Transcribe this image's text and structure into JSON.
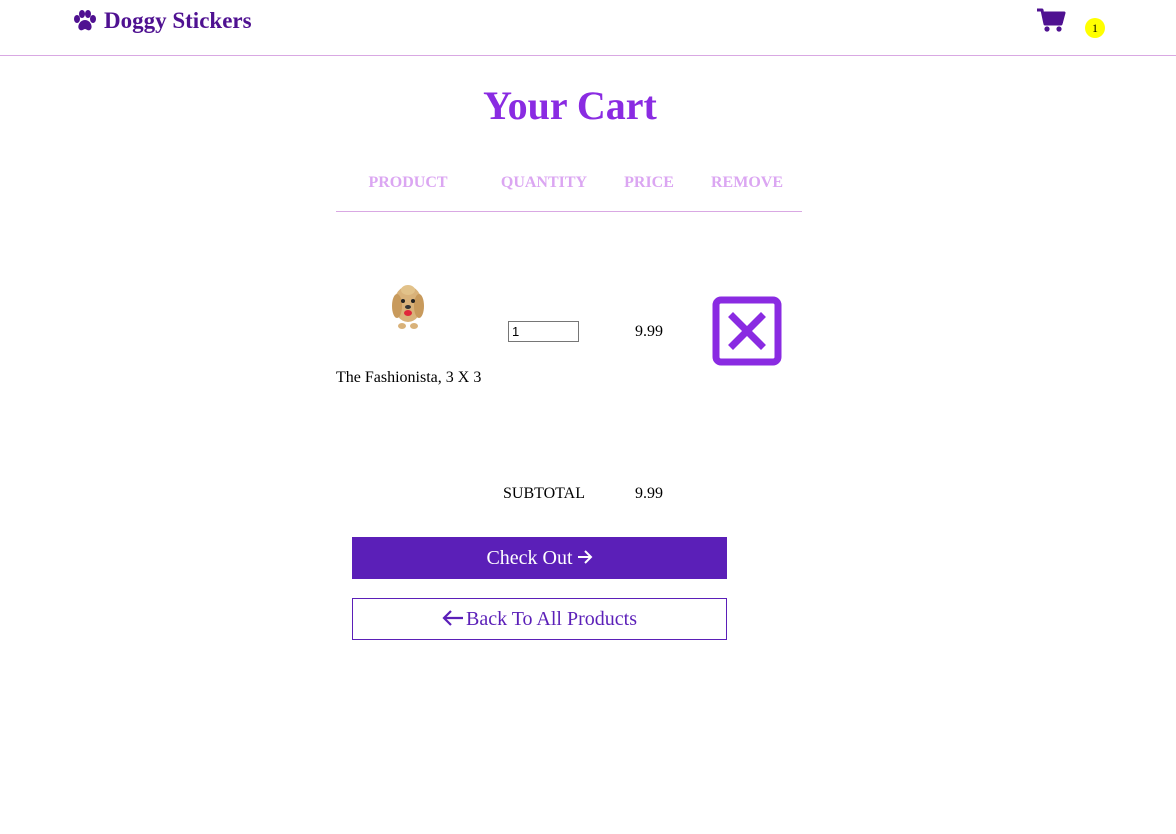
{
  "navbar": {
    "brand_label": "Doggy Stickers",
    "brand_icon": "paw-icon",
    "cart_icon": "shopping-cart-icon",
    "cart_count": "1",
    "brand_color": "#4f1191",
    "badge_color": "#ffff00"
  },
  "cart": {
    "title": "Your Cart",
    "columns": {
      "product": "PRODUCT",
      "quantity": "QUANTITY",
      "price": "PRICE",
      "remove": "REMOVE"
    },
    "items": [
      {
        "name": "The Fashionista, 3 X 3",
        "quantity": "1",
        "price": "9.99",
        "remove_icon": "close-box-icon"
      }
    ],
    "subtotal_label": "SUBTOTAL",
    "subtotal_value": "9.99",
    "checkout_label": "Check Out",
    "checkout_icon": "arrow-right-icon",
    "back_label": "Back To All Products",
    "back_icon": "arrow-left-icon"
  },
  "colors": {
    "accent": "#8a2be2",
    "button": "#5b1fb8",
    "header_text": "#dba6f2",
    "divider": "#d9a8e3"
  }
}
